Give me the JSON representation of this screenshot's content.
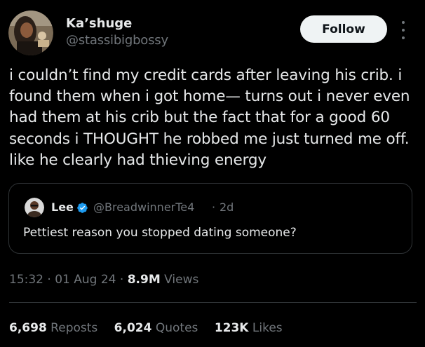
{
  "author": {
    "display_name": "Ka’shuge",
    "handle": "@stassibigbossy",
    "avatar_icon": "user-avatar"
  },
  "follow_button": {
    "label": "Follow"
  },
  "more_menu_icon": "more-vertical-icon",
  "tweet": {
    "text": "i couldn’t find my credit cards after leaving his crib. i\nfound them when i got home— turns out i never even\nhad them at his crib but the fact that for a good 60\nseconds i THOUGHT he robbed me just turned me off.\nlike he clearly had thieving energy"
  },
  "quote": {
    "name": "Lee",
    "verified_icon": "verified-badge-icon",
    "handle": "@BreadwinnerTe4",
    "separator": "·",
    "time": "2d",
    "text": "Pettiest reason you stopped dating someone?"
  },
  "meta": {
    "time": "15:32",
    "sep1": " · ",
    "date": "01 Aug 24",
    "sep2": " · ",
    "views_count": "8.9M",
    "views_label": " Views"
  },
  "stats": {
    "reposts_count": "6,698",
    "reposts_label": " Reposts",
    "quotes_count": "6,024",
    "quotes_label": " Quotes",
    "likes_count": "123K",
    "likes_label": " Likes"
  },
  "colors": {
    "background": "#000000",
    "primary_text": "#e7e9ea",
    "secondary_text": "#71767b",
    "border": "#2f3336",
    "verified_blue": "#1d9bf0",
    "follow_button_bg": "#eff3f4"
  }
}
